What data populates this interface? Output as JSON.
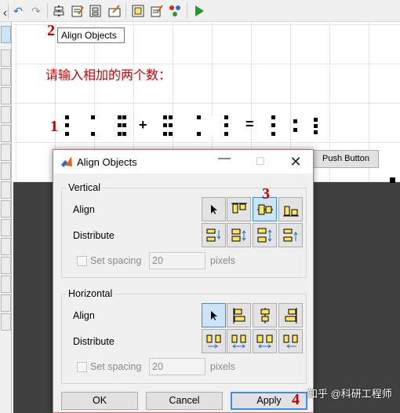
{
  "annotations": {
    "n1": "1",
    "n2": "2",
    "n3": "3",
    "n4": "4"
  },
  "tooltip": "Align Objects",
  "canvas": {
    "prompt": "请输入相加的两个数：",
    "plus": "+",
    "equals": "=",
    "push_button": "Push Button"
  },
  "dialog": {
    "title": "Align Objects",
    "vertical": {
      "title": "Vertical",
      "align_label": "Align",
      "distribute_label": "Distribute",
      "spacing_label": "Set spacing",
      "spacing_value": "20",
      "units": "pixels"
    },
    "horizontal": {
      "title": "Horizontal",
      "align_label": "Align",
      "distribute_label": "Distribute",
      "spacing_label": "Set spacing",
      "spacing_value": "20",
      "units": "pixels"
    },
    "buttons": {
      "ok": "OK",
      "cancel": "Cancel",
      "apply": "Apply"
    }
  },
  "watermark": "知乎 @科研工程师",
  "colors": {
    "annotation": "#c00000",
    "prompt_text": "#d00000",
    "selected_border": "#3a8ee6",
    "icon_fill": "#ffe45c"
  }
}
